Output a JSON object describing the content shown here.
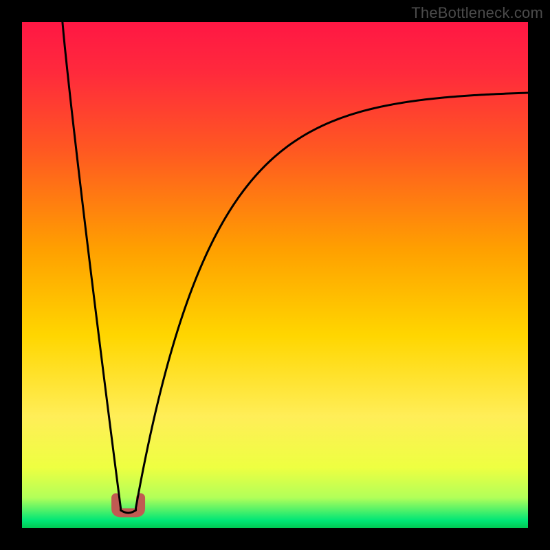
{
  "watermark": "TheBottleneck.com",
  "chart_data": {
    "type": "line",
    "title": "",
    "xlabel": "",
    "ylabel": "",
    "xlim": [
      0,
      100
    ],
    "ylim": [
      0,
      100
    ],
    "grid": false,
    "legend": false,
    "gradient_stops": [
      {
        "offset": 0,
        "color": "#ff1744"
      },
      {
        "offset": 0.1,
        "color": "#ff2a3c"
      },
      {
        "offset": 0.25,
        "color": "#ff5722"
      },
      {
        "offset": 0.45,
        "color": "#ffa000"
      },
      {
        "offset": 0.62,
        "color": "#ffd600"
      },
      {
        "offset": 0.78,
        "color": "#ffee58"
      },
      {
        "offset": 0.88,
        "color": "#eeff41"
      },
      {
        "offset": 0.94,
        "color": "#b2ff59"
      },
      {
        "offset": 0.985,
        "color": "#00e676"
      },
      {
        "offset": 1.0,
        "color": "#00c853"
      }
    ],
    "series": [
      {
        "name": "bottleneck-curve",
        "x_min": 18,
        "x_notch_start": 19.5,
        "x_notch_end": 22.5,
        "y_top": 100,
        "y_notch_floor": 4,
        "y_right_end": 86,
        "stroke": "#000000",
        "stroke_width": 3
      }
    ],
    "marker": {
      "name": "optimal-marker",
      "x": 21,
      "y": 3,
      "color": "#c05a52",
      "shape": "u"
    }
  }
}
